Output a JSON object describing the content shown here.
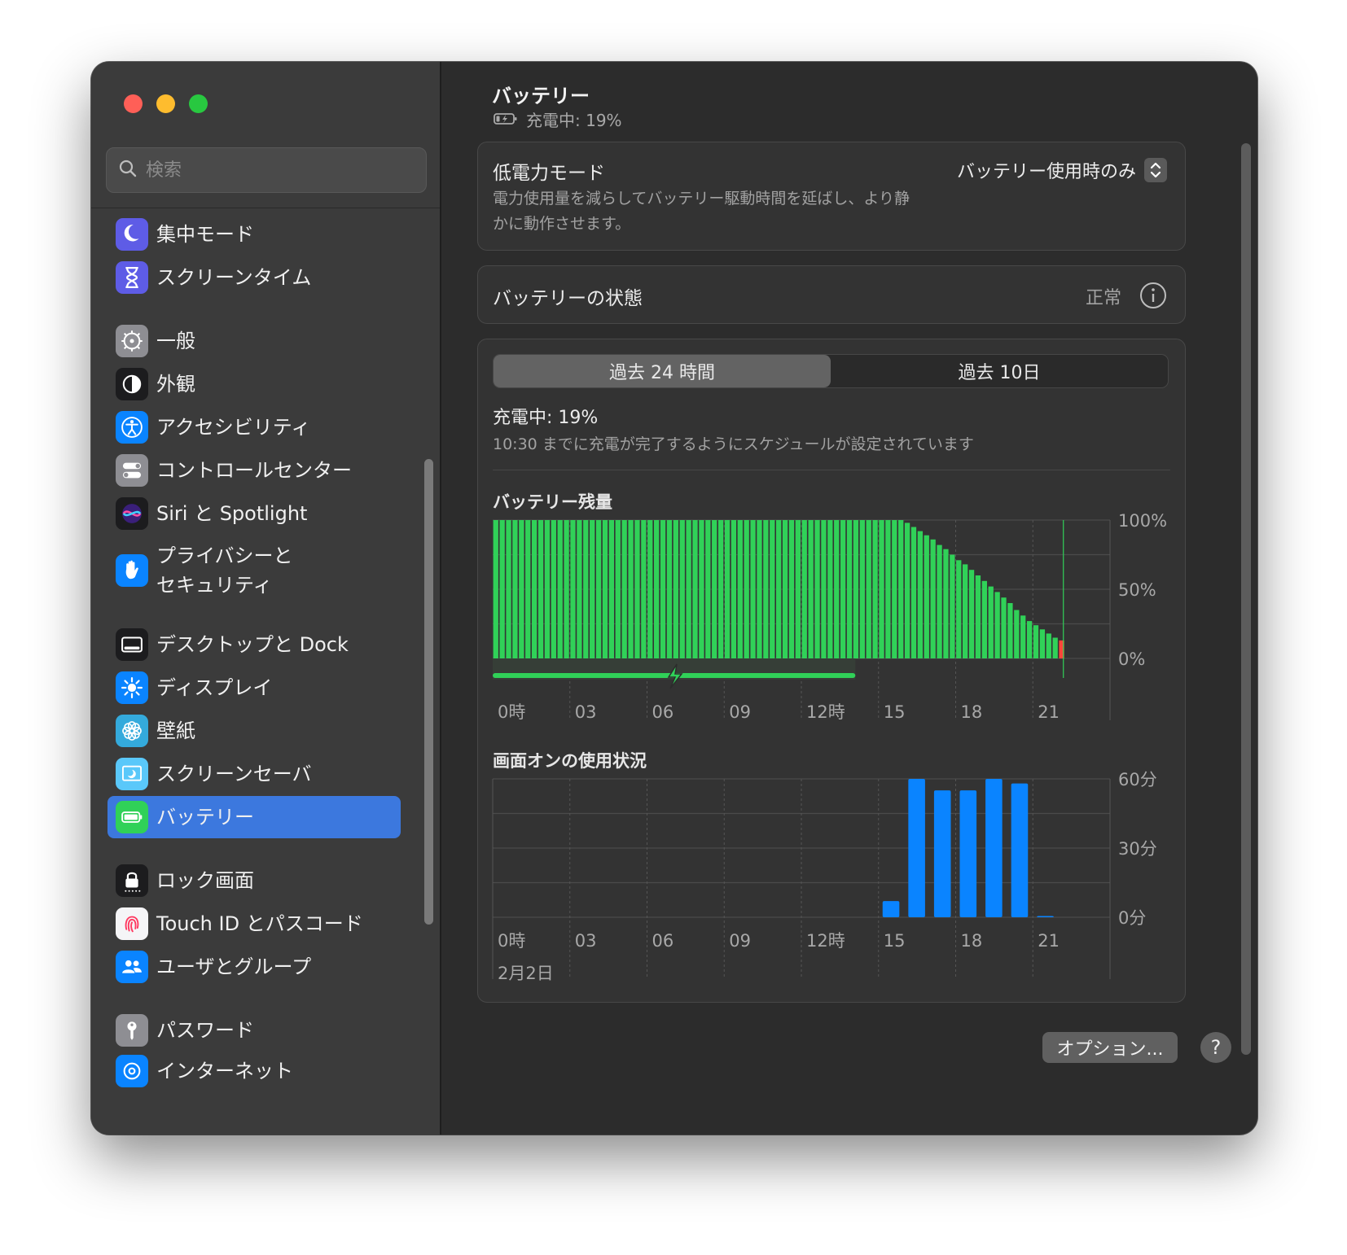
{
  "window": {
    "sidebar": {
      "search_placeholder": "検索",
      "items": [
        {
          "label": "集中モード",
          "icon": "moon-icon",
          "color": "#5e5ce6"
        },
        {
          "label": "スクリーンタイム",
          "icon": "hourglass-icon",
          "color": "#5e5ce6"
        },
        {
          "label": "一般",
          "icon": "gear-icon",
          "color": "#8e8e93"
        },
        {
          "label": "外観",
          "icon": "appearance-icon",
          "color": "#1c1c1e"
        },
        {
          "label": "アクセシビリティ",
          "icon": "accessibility-icon",
          "color": "#0a84ff"
        },
        {
          "label": "コントロールセンター",
          "icon": "toggles-icon",
          "color": "#8e8e93"
        },
        {
          "label": "Siri と Spotlight",
          "icon": "siri-icon",
          "color": "#1c1c1e"
        },
        {
          "label": "プライバシーと\nセキュリティ",
          "icon": "hand-icon",
          "color": "#0a84ff"
        },
        {
          "label": "デスクトップと Dock",
          "icon": "dock-icon",
          "color": "#1c1c1e"
        },
        {
          "label": "ディスプレイ",
          "icon": "sun-icon",
          "color": "#0a84ff"
        },
        {
          "label": "壁紙",
          "icon": "flower-icon",
          "color": "#34aadc"
        },
        {
          "label": "スクリーンセーバ",
          "icon": "screensaver-icon",
          "color": "#5ac8fa"
        },
        {
          "label": "バッテリー",
          "icon": "battery-icon",
          "color": "#30d158"
        },
        {
          "label": "ロック画面",
          "icon": "lock-icon",
          "color": "#1c1c1e"
        },
        {
          "label": "Touch ID とパスコード",
          "icon": "fingerprint-icon",
          "color": "#f5f5f7"
        },
        {
          "label": "ユーザとグループ",
          "icon": "users-icon",
          "color": "#0a84ff"
        },
        {
          "label": "パスワード",
          "icon": "key-icon",
          "color": "#8e8e93"
        },
        {
          "label": "インターネット",
          "icon": "at-icon",
          "color": "#0a84ff"
        }
      ],
      "selected_index": 12
    },
    "header": {
      "title": "バッテリー",
      "status": "充電中: 19%"
    },
    "low_power": {
      "title": "低電力モード",
      "description": "電力使用量を減らしてバッテリー駆動時間を延ばし、より静\nかに動作させます。",
      "value": "バッテリー使用時のみ"
    },
    "health": {
      "title": "バッテリーの状態",
      "value": "正常"
    },
    "usage": {
      "tabs": [
        "過去 24 時間",
        "過去 10日"
      ],
      "active_tab": 0,
      "status": "充電中: 19%",
      "schedule_note": "10:30 までに充電が完了するようにスケジュールが設定されています"
    },
    "footer": {
      "options_label": "オプション...",
      "help_label": "?"
    }
  },
  "chart_data": [
    {
      "type": "bar",
      "title": "バッテリー残量",
      "x_tick_labels": [
        "0時",
        "03",
        "06",
        "09",
        "12時",
        "15",
        "18",
        "21"
      ],
      "y_tick_labels": [
        "100%",
        "50%",
        "0%"
      ],
      "ylim": [
        0,
        100
      ],
      "hours_span": 24,
      "bar_interval_hours": 0.25,
      "charging_until_hour": 14.1,
      "series": [
        {
          "values": [
            100,
            100,
            100,
            100,
            100,
            100,
            100,
            100,
            100,
            100,
            100,
            100,
            100,
            100,
            100,
            100,
            100,
            100,
            100,
            100,
            100,
            100,
            100,
            100,
            100,
            100,
            100,
            100,
            100,
            100,
            100,
            100,
            100,
            100,
            100,
            100,
            100,
            100,
            100,
            100,
            100,
            100,
            100,
            100,
            100,
            100,
            100,
            100,
            100,
            100,
            100,
            100,
            100,
            100,
            100,
            100,
            100,
            100,
            100,
            100,
            100,
            100,
            100,
            100,
            98,
            95,
            92,
            89,
            86,
            82,
            79,
            75,
            71,
            68,
            64,
            60,
            56,
            52,
            48,
            44,
            40,
            35,
            31,
            27,
            24,
            21,
            18,
            15,
            13
          ]
        }
      ],
      "final_value": 13,
      "colors": {
        "bar": "#30d158",
        "low": "#ff453a"
      }
    },
    {
      "type": "bar",
      "title": "画面オンの使用状況",
      "x_tick_labels": [
        "0時",
        "03",
        "06",
        "09",
        "12時",
        "15",
        "18",
        "21"
      ],
      "date_label": "2月2日",
      "y_tick_labels": [
        "60分",
        "30分",
        "0分"
      ],
      "ylim": [
        0,
        60
      ],
      "categories_hours": [
        15,
        16,
        17,
        18,
        19,
        20,
        21
      ],
      "series": [
        {
          "values": [
            7,
            60,
            55,
            55,
            60,
            58,
            0.5
          ]
        }
      ],
      "colors": {
        "bar": "#0a84ff"
      }
    }
  ]
}
